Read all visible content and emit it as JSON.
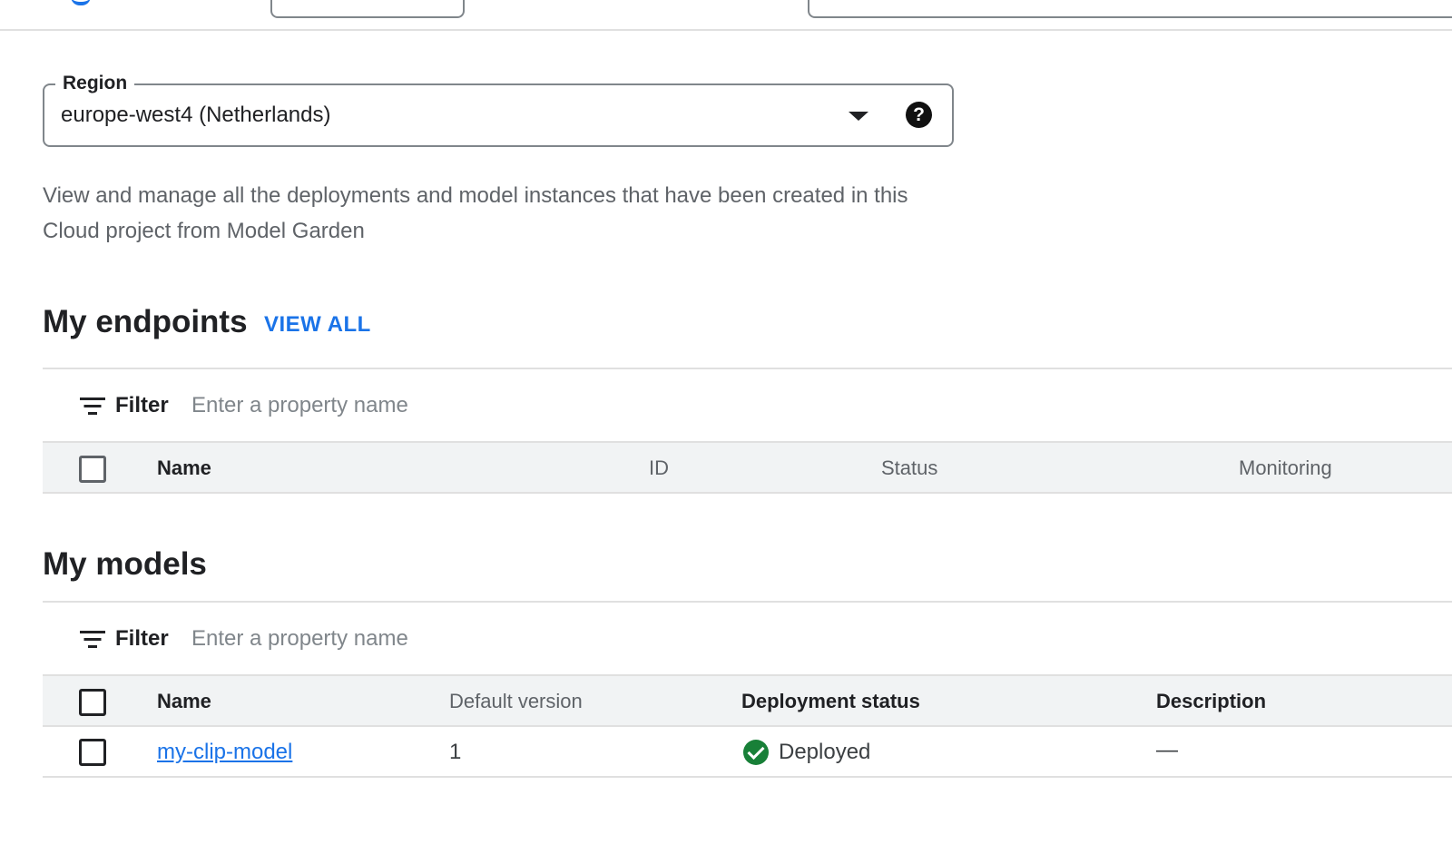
{
  "region": {
    "label": "Region",
    "value": "europe-west4 (Netherlands)",
    "help_icon": "?"
  },
  "description": "View and manage all the deployments and model instances that have been created in this Cloud project from Model Garden",
  "endpoints": {
    "title": "My endpoints",
    "view_all_label": "VIEW ALL",
    "filter": {
      "label": "Filter",
      "placeholder": "Enter a property name"
    },
    "columns": [
      "Name",
      "ID",
      "Status",
      "Monitoring"
    ]
  },
  "models": {
    "title": "My models",
    "filter": {
      "label": "Filter",
      "placeholder": "Enter a property name"
    },
    "columns": [
      "Name",
      "Default version",
      "Deployment status",
      "Description"
    ],
    "rows": [
      {
        "name": "my-clip-model",
        "default_version": "1",
        "deployment_status": "Deployed",
        "description": "—"
      }
    ]
  },
  "colors": {
    "accent": "#1a73e8",
    "status_ok": "#188038"
  },
  "icons": {
    "filter": "filter-icon",
    "dropdown": "chevron-down-icon",
    "help": "help-icon",
    "status": "check-circle-icon"
  }
}
